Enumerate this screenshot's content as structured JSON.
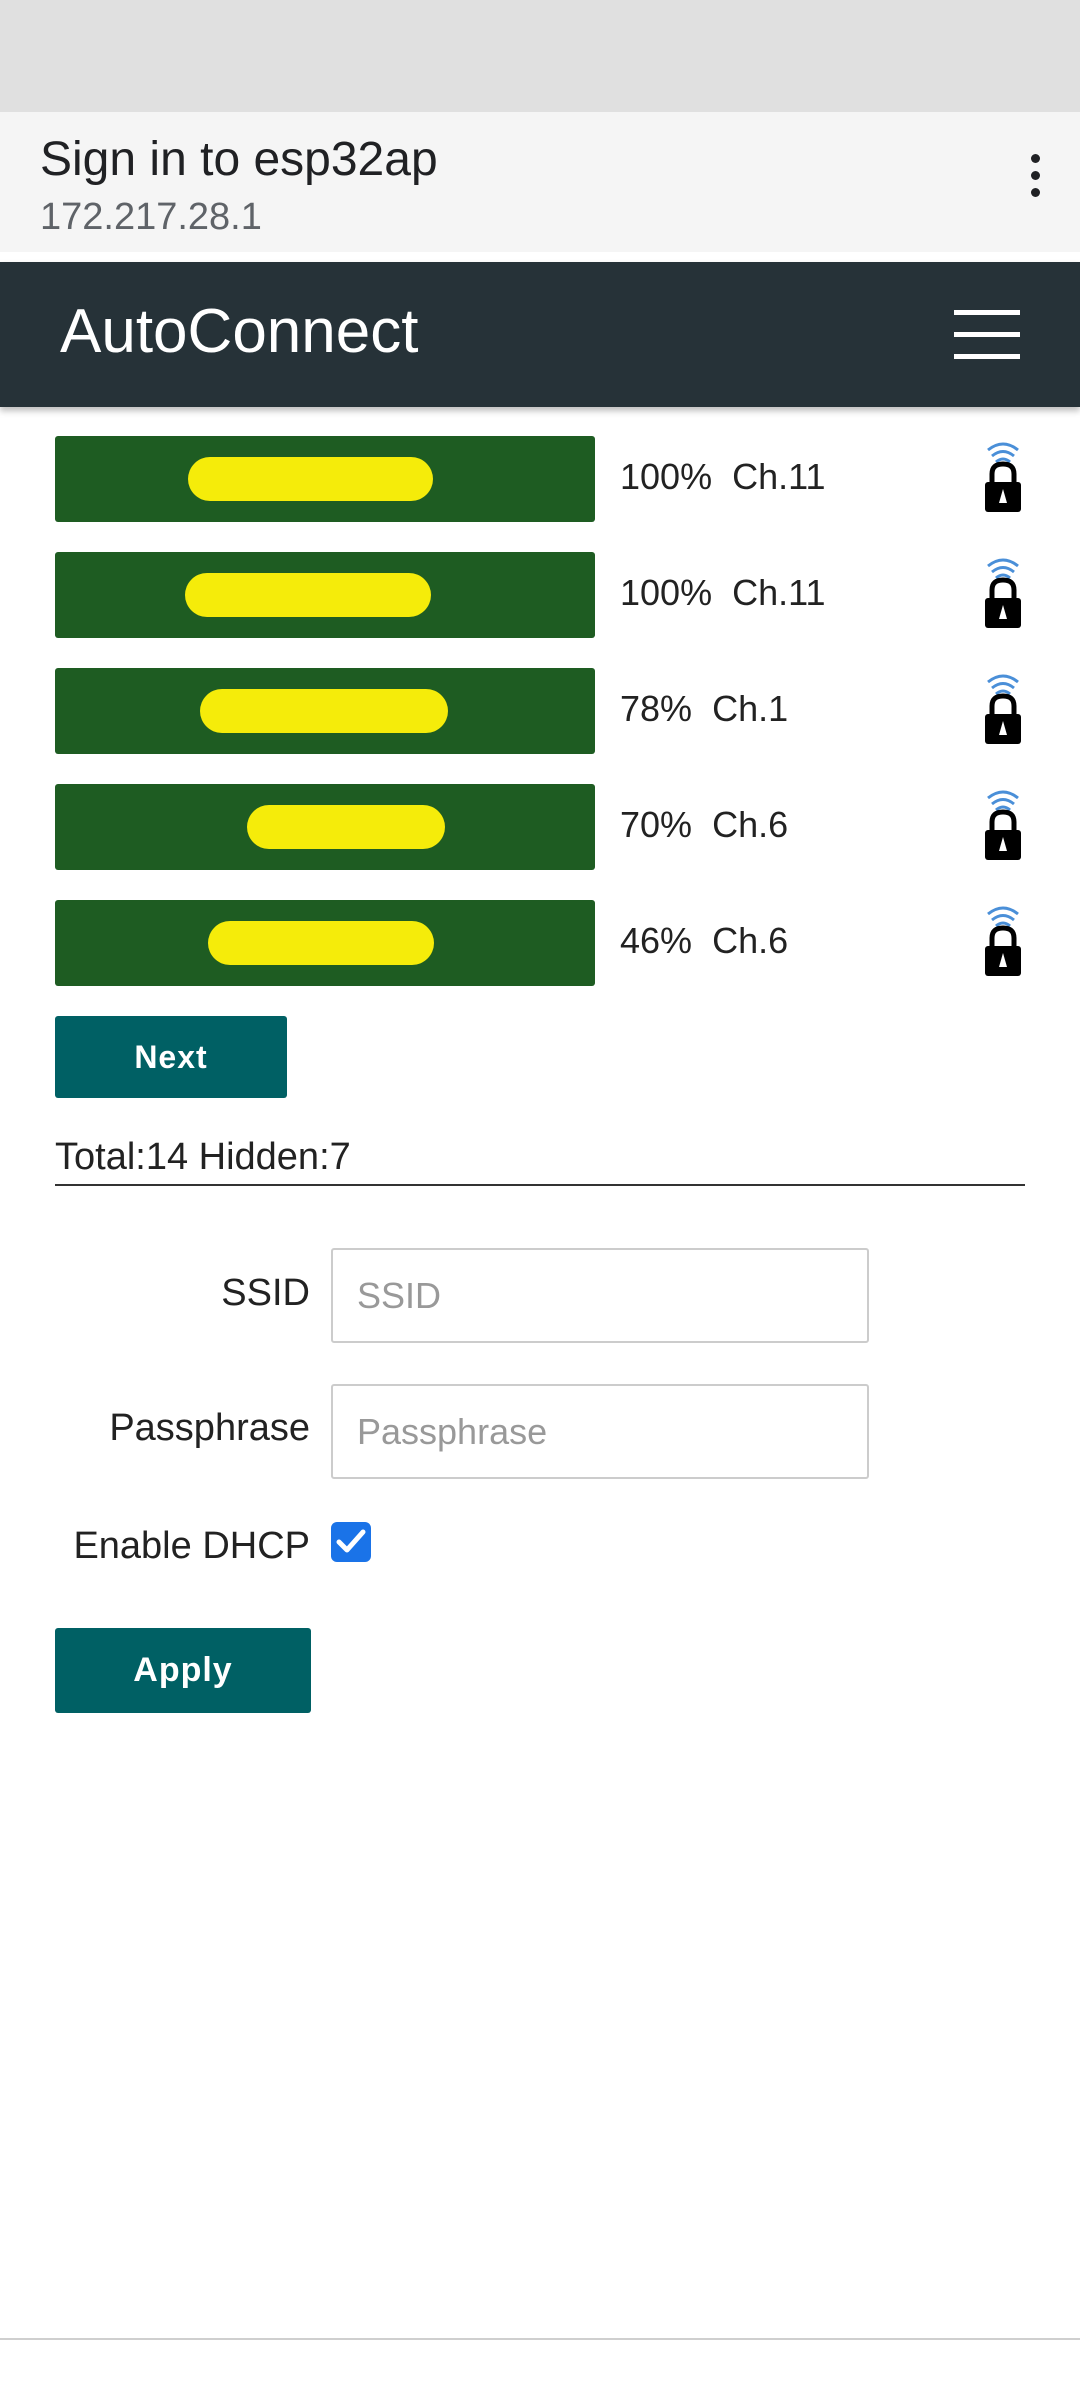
{
  "browser": {
    "title": "Sign in to esp32ap",
    "url": "172.217.28.1",
    "menu_icon": "kebab-menu-icon"
  },
  "app": {
    "title": "AutoConnect",
    "menu_icon": "hamburger-icon"
  },
  "colors": {
    "app_bar": "#263238",
    "network_button": "#1e5c22",
    "redaction": "#f5ec0a",
    "action_button": "#006064",
    "checkbox": "#1a73e8"
  },
  "networks": [
    {
      "signal": "100%",
      "channel": "Ch.11",
      "secured": true
    },
    {
      "signal": "100%",
      "channel": "Ch.11",
      "secured": true
    },
    {
      "signal": "78%",
      "channel": "Ch.1",
      "secured": true
    },
    {
      "signal": "70%",
      "channel": "Ch.6",
      "secured": true
    },
    {
      "signal": "46%",
      "channel": "Ch.6",
      "secured": true
    }
  ],
  "next_label": "Next",
  "summary": "Total:14 Hidden:7",
  "form": {
    "ssid_label": "SSID",
    "ssid_placeholder": "SSID",
    "passphrase_label": "Passphrase",
    "passphrase_placeholder": "Passphrase",
    "dhcp_label": "Enable DHCP",
    "dhcp_checked": true,
    "apply_label": "Apply"
  }
}
